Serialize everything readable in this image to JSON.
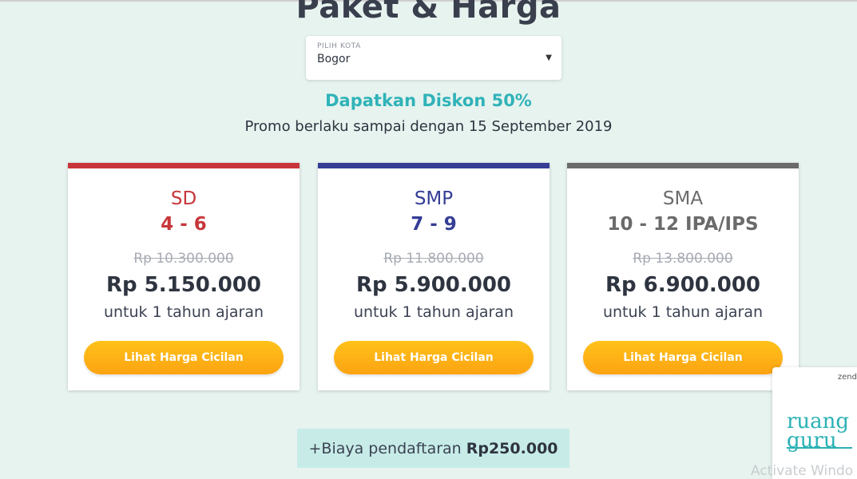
{
  "heading": "Paket & Harga",
  "city_select": {
    "label": "PILIH KOTA",
    "value": "Bogor"
  },
  "discount": "Dapatkan Diskon 50%",
  "promo": "Promo berlaku sampai dengan 15 September 2019",
  "cards": [
    {
      "level": "SD",
      "grade": "4 - 6",
      "old_price": "Rp 10.300.000",
      "price": "Rp 5.150.000",
      "period": "untuk 1 tahun ajaran",
      "button": "Lihat Harga Cicilan",
      "accent": "#c7363a"
    },
    {
      "level": "SMP",
      "grade": "7 - 9",
      "old_price": "Rp 11.800.000",
      "price": "Rp 5.900.000",
      "period": "untuk 1 tahun ajaran",
      "button": "Lihat Harga Cicilan",
      "accent": "#353d95"
    },
    {
      "level": "SMA",
      "grade": "10 - 12 IPA/IPS",
      "old_price": "Rp 13.800.000",
      "price": "Rp 6.900.000",
      "period": "untuk 1 tahun ajaran",
      "button": "Lihat Harga Cicilan",
      "accent": "#6b6b6b"
    }
  ],
  "fee": {
    "text": "+Biaya pendaftaran",
    "amount": "Rp250.000"
  },
  "chat_widget": {
    "brand": "zend",
    "logo_line1": "ruang",
    "logo_line2": "guru"
  },
  "watermark": "Activate Windo",
  "colors": {
    "background": "#e7f3ef",
    "teal": "#2fb3b8",
    "button": "#fcae14"
  }
}
